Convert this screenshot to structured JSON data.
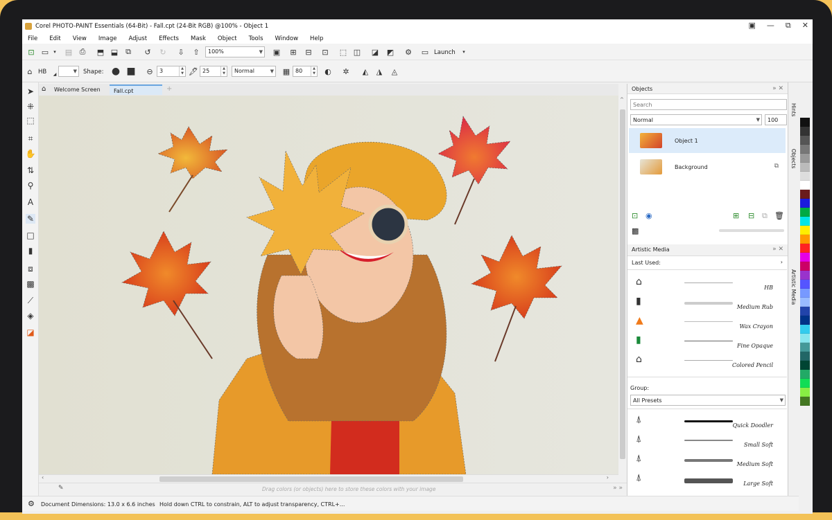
{
  "window": {
    "title": "Corel PHOTO-PAINT Essentials (64-Bit) - Fall.cpt (24-Bit RGB) @100% - Object 1",
    "controls": [
      "▣",
      "—",
      "⧉",
      "✕"
    ]
  },
  "menu": [
    "File",
    "Edit",
    "View",
    "Image",
    "Adjust",
    "Effects",
    "Mask",
    "Object",
    "Tools",
    "Window",
    "Help"
  ],
  "toolbar": {
    "zoom": "100%",
    "launch_label": "Launch"
  },
  "property_bar": {
    "brush_name": "HB",
    "shape_label": "Shape:",
    "size": "3",
    "nib_size": "25",
    "blend_mode": "Normal",
    "transparency": "80"
  },
  "doc_tabs": [
    "Welcome Screen",
    "Fall.cpt",
    "+"
  ],
  "colorwell_hint": "Drag colors (or objects) here to store these colors with your image",
  "status": {
    "dimensions": "Document Dimensions: 13.0 x 6.6 inches",
    "hint": "Hold down CTRL to constrain, ALT to adjust transparency, CTRL+..."
  },
  "objects_panel": {
    "title": "Objects",
    "search_placeholder": "Search",
    "blend_mode": "Normal",
    "opacity": "100",
    "layers": [
      "Object 1",
      "Background"
    ]
  },
  "artistic_media": {
    "title": "Artistic Media",
    "last_used_label": "Last Used:",
    "last_used": [
      "HB",
      "Medium Rub",
      "Wax Crayon",
      "Fine Opaque",
      "Colored Pencil"
    ],
    "group_label": "Group:",
    "group_value": "All Presets",
    "presets": [
      "Quick Doodler",
      "Small Soft",
      "Medium Soft",
      "Large Soft"
    ]
  },
  "side_tabs": [
    "Hints",
    "Objects",
    "Artistic Media"
  ],
  "palette_colors": [
    "#111111",
    "#333333",
    "#555555",
    "#777777",
    "#999999",
    "#bbbbbb",
    "#dddddd",
    "#ffffff",
    "#6a1b1b",
    "#1b1bdd",
    "#00aa44",
    "#00e6e6",
    "#ffee00",
    "#ff9900",
    "#ff2222",
    "#e600e6",
    "#cc0066",
    "#9933cc",
    "#5555ff",
    "#7799ff",
    "#99bbff",
    "#2244aa",
    "#003388",
    "#33ccee",
    "#88e6ee",
    "#449999",
    "#226666",
    "#004433",
    "#22aa66",
    "#11dd55",
    "#88ee44",
    "#447722"
  ]
}
